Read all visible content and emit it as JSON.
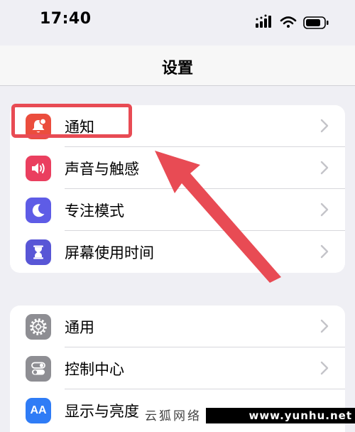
{
  "status_bar": {
    "time": "17:40",
    "icons": [
      "cellular-signal-icon",
      "wifi-icon",
      "battery-icon"
    ]
  },
  "nav": {
    "title": "设置"
  },
  "groups": [
    {
      "items": [
        {
          "label": "通知",
          "icon": "bell-badge-icon",
          "color": "#eb4d3d"
        },
        {
          "label": "声音与触感",
          "icon": "speaker-icon",
          "color": "#ea3f5f"
        },
        {
          "label": "专注模式",
          "icon": "moon-icon",
          "color": "#5e5ce6"
        },
        {
          "label": "屏幕使用时间",
          "icon": "hourglass-icon",
          "color": "#5856d6"
        }
      ]
    },
    {
      "items": [
        {
          "label": "通用",
          "icon": "gear-icon",
          "color": "#8e8e93"
        },
        {
          "label": "控制中心",
          "icon": "toggles-icon",
          "color": "#8e8e93"
        },
        {
          "label": "显示与亮度",
          "icon": "text-size-icon",
          "color": "#2f7cf6",
          "icon_text": "AA"
        }
      ]
    }
  ],
  "annotation": {
    "highlight_color": "#e84b54",
    "highlighted_item": "通知"
  },
  "watermark": {
    "brand": "云狐网络",
    "url": "www.yunhu.net"
  }
}
